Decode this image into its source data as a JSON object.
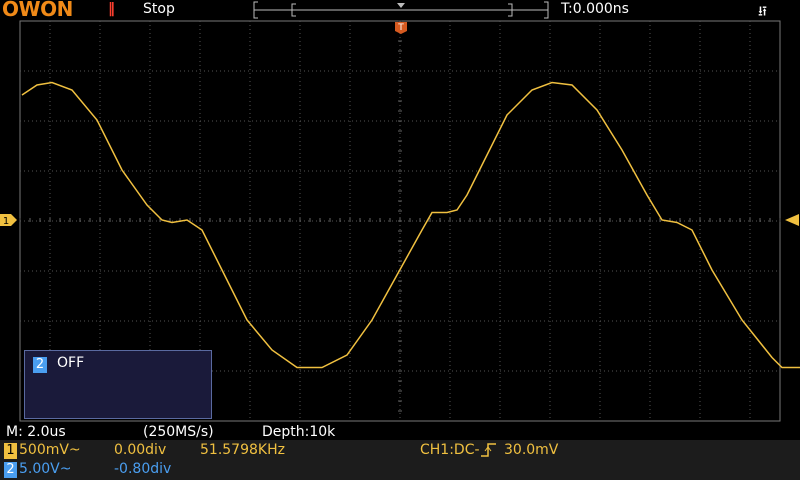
{
  "header": {
    "brand": "OWON",
    "run_icon": "‖",
    "run_status": "Stop",
    "trigger_delay": "T:0.000ns",
    "usb_icon": "usb-icon"
  },
  "markers": {
    "ch1_label": "1",
    "trigger_pos": "T"
  },
  "ch2_panel": {
    "badge": "2",
    "state": "OFF"
  },
  "status": {
    "timebase": "M: 2.0us",
    "sample_rate": "(250MS/s)",
    "depth": "Depth:10k"
  },
  "ch1": {
    "badge": "1",
    "scale": "500mV~",
    "offset": "0.00div",
    "frequency": "51.5798KHz",
    "trigger": "CH1:DC-",
    "trigger_level": "30.0mV"
  },
  "ch2": {
    "badge": "2",
    "scale": "5.00V~",
    "offset": "-0.80div"
  },
  "colors": {
    "ch1": "#f0c040",
    "ch2": "#4a9ef0",
    "brand": "#f08a18",
    "grid": "#555555"
  },
  "waveform": {
    "ch1_points_div": [
      [
        0,
        2.5
      ],
      [
        0.3,
        2.7
      ],
      [
        0.6,
        2.75
      ],
      [
        1.0,
        2.6
      ],
      [
        1.5,
        2.0
      ],
      [
        2.0,
        1.0
      ],
      [
        2.5,
        0.3
      ],
      [
        2.8,
        0.0
      ],
      [
        3.0,
        -0.05
      ],
      [
        3.3,
        0.0
      ],
      [
        3.6,
        -0.2
      ],
      [
        4.0,
        -1.0
      ],
      [
        4.5,
        -2.0
      ],
      [
        5.0,
        -2.6
      ],
      [
        5.5,
        -2.95
      ],
      [
        6.0,
        -2.95
      ],
      [
        6.5,
        -2.7
      ],
      [
        7.0,
        -2.0
      ],
      [
        7.5,
        -1.1
      ],
      [
        8.0,
        -0.2
      ],
      [
        8.2,
        0.15
      ],
      [
        8.5,
        0.15
      ],
      [
        8.7,
        0.2
      ],
      [
        8.9,
        0.5
      ],
      [
        9.2,
        1.1
      ],
      [
        9.7,
        2.1
      ],
      [
        10.2,
        2.6
      ],
      [
        10.6,
        2.75
      ],
      [
        11.0,
        2.7
      ],
      [
        11.5,
        2.2
      ],
      [
        12.0,
        1.4
      ],
      [
        12.5,
        0.5
      ],
      [
        12.8,
        0.0
      ],
      [
        13.1,
        -0.05
      ],
      [
        13.4,
        -0.2
      ],
      [
        13.8,
        -1.0
      ],
      [
        14.4,
        -2.0
      ],
      [
        15.0,
        -2.75
      ],
      [
        15.2,
        -2.95
      ],
      [
        15.6,
        -2.95
      ]
    ]
  }
}
